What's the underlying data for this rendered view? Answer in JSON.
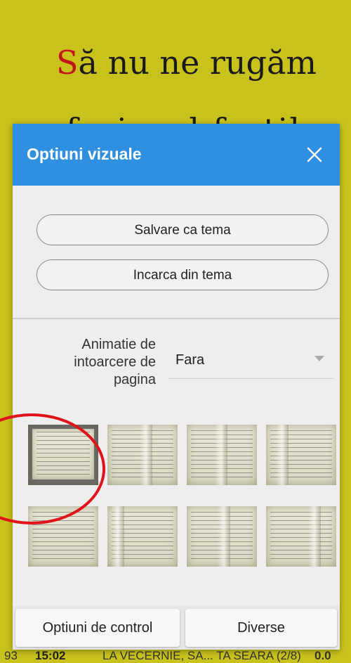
{
  "reader": {
    "line1_dropcap": "S",
    "line1_rest": "ă nu ne rugăm",
    "line2": "ca fariseul fratilor"
  },
  "status": {
    "left": "93",
    "time": "15:02",
    "title": "LA VECERNIE, SA... TA SEARA (2/8)",
    "right": "0.0"
  },
  "dialog": {
    "title": "Optiuni vizuale",
    "close_icon": "close-icon",
    "save_theme_label": "Salvare ca tema",
    "load_theme_label": "Incarca din tema",
    "page_turn_label": "Animatie de intoarcere de pagina",
    "page_turn_value": "Fara",
    "bottom_buttons": {
      "control_label": "Optiuni de control",
      "misc_label": "Diverse"
    }
  },
  "colors": {
    "header_blue": "#2f8fe0",
    "reader_bg": "#c9c21c",
    "highlight_red": "#e0131a"
  }
}
